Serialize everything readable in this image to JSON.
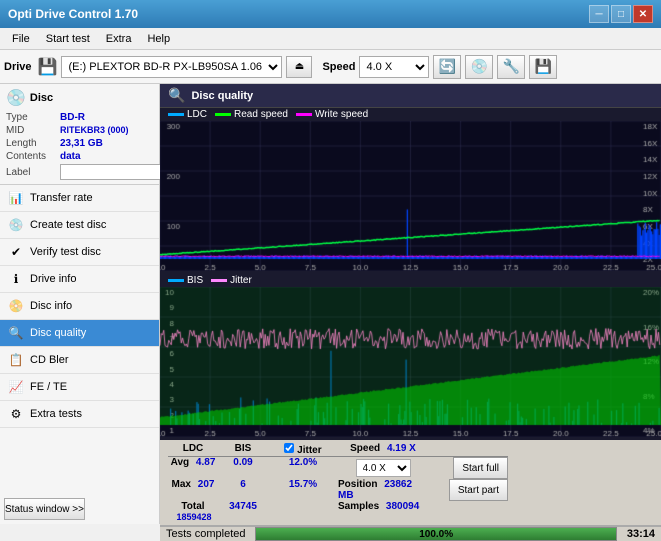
{
  "app": {
    "title": "Opti Drive Control 1.70",
    "window_controls": [
      "minimize",
      "maximize",
      "close"
    ]
  },
  "menu": {
    "items": [
      "File",
      "Start test",
      "Extra",
      "Help"
    ]
  },
  "drivebar": {
    "label": "Drive",
    "drive_value": "(E:) PLEXTOR BD-R  PX-LB950SA 1.06",
    "speed_label": "Speed",
    "speed_value": "4.0 X"
  },
  "disc": {
    "header": "Disc",
    "type_label": "Type",
    "type_value": "BD-R",
    "mid_label": "MID",
    "mid_value": "RITEKBR3 (000)",
    "length_label": "Length",
    "length_value": "23,31 GB",
    "contents_label": "Contents",
    "contents_value": "data",
    "label_label": "Label",
    "label_value": ""
  },
  "nav": {
    "items": [
      {
        "id": "transfer-rate",
        "label": "Transfer rate",
        "icon": "📊"
      },
      {
        "id": "create-test-disc",
        "label": "Create test disc",
        "icon": "💿"
      },
      {
        "id": "verify-test-disc",
        "label": "Verify test disc",
        "icon": "✔"
      },
      {
        "id": "drive-info",
        "label": "Drive info",
        "icon": "ℹ"
      },
      {
        "id": "disc-info",
        "label": "Disc info",
        "icon": "📀"
      },
      {
        "id": "disc-quality",
        "label": "Disc quality",
        "icon": "🔍",
        "active": true
      },
      {
        "id": "cd-bler",
        "label": "CD Bler",
        "icon": "📋"
      },
      {
        "id": "fe-te",
        "label": "FE / TE",
        "icon": "📈"
      },
      {
        "id": "extra-tests",
        "label": "Extra tests",
        "icon": "⚙"
      }
    ]
  },
  "status_window_btn": "Status window >>",
  "chart": {
    "title": "Disc quality",
    "legend_top": [
      {
        "label": "LDC",
        "color": "#00aaff"
      },
      {
        "label": "Read speed",
        "color": "#00ff00"
      },
      {
        "label": "Write speed",
        "color": "#ff00ff"
      }
    ],
    "legend_bot": [
      {
        "label": "BIS",
        "color": "#00aaff"
      },
      {
        "label": "Jitter",
        "color": "#ff88ff"
      }
    ]
  },
  "stats": {
    "ldc_header": "LDC",
    "bis_header": "BIS",
    "jitter_header": "Jitter",
    "speed_header": "Speed",
    "position_header": "Position",
    "samples_header": "Samples",
    "avg_label": "Avg",
    "max_label": "Max",
    "total_label": "Total",
    "ldc_avg": "4.87",
    "ldc_max": "207",
    "ldc_total": "1859428",
    "bis_avg": "0.09",
    "bis_max": "6",
    "bis_total": "34745",
    "jitter_avg": "12.0%",
    "jitter_max": "15.7%",
    "jitter_total": "",
    "speed_val": "4.19 X",
    "speed_sel": "4.0 X",
    "position_val": "23862 MB",
    "samples_val": "380094",
    "jitter_checked": true,
    "jitter_label": "Jitter"
  },
  "buttons": {
    "start_full": "Start full",
    "start_part": "Start part"
  },
  "bottombar": {
    "status": "Tests completed",
    "progress": "100.0%",
    "time": "33:14"
  }
}
